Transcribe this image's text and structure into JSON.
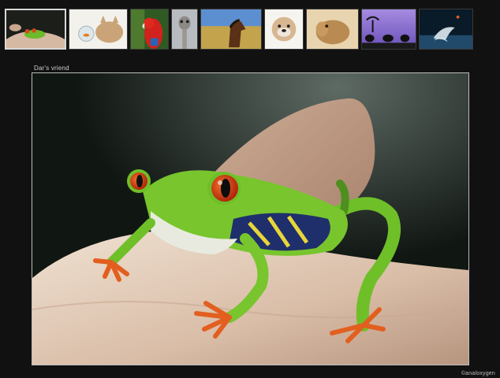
{
  "gallery": {
    "caption": "Dar's vriend",
    "credit": "©analoxygen",
    "active_index": 0,
    "thumbnails": [
      {
        "subject": "tree frog on hand"
      },
      {
        "subject": "cat with goldfish bowl"
      },
      {
        "subject": "red parrot"
      },
      {
        "subject": "ostrich"
      },
      {
        "subject": "horse in field"
      },
      {
        "subject": "bulldog"
      },
      {
        "subject": "camel"
      },
      {
        "subject": "elephants at sunset"
      },
      {
        "subject": "leaping dolphin"
      }
    ]
  },
  "colors": {
    "background": "#111111",
    "frame_border": "#bdbdbd",
    "active_thumb_border": "#d8d8d8"
  }
}
